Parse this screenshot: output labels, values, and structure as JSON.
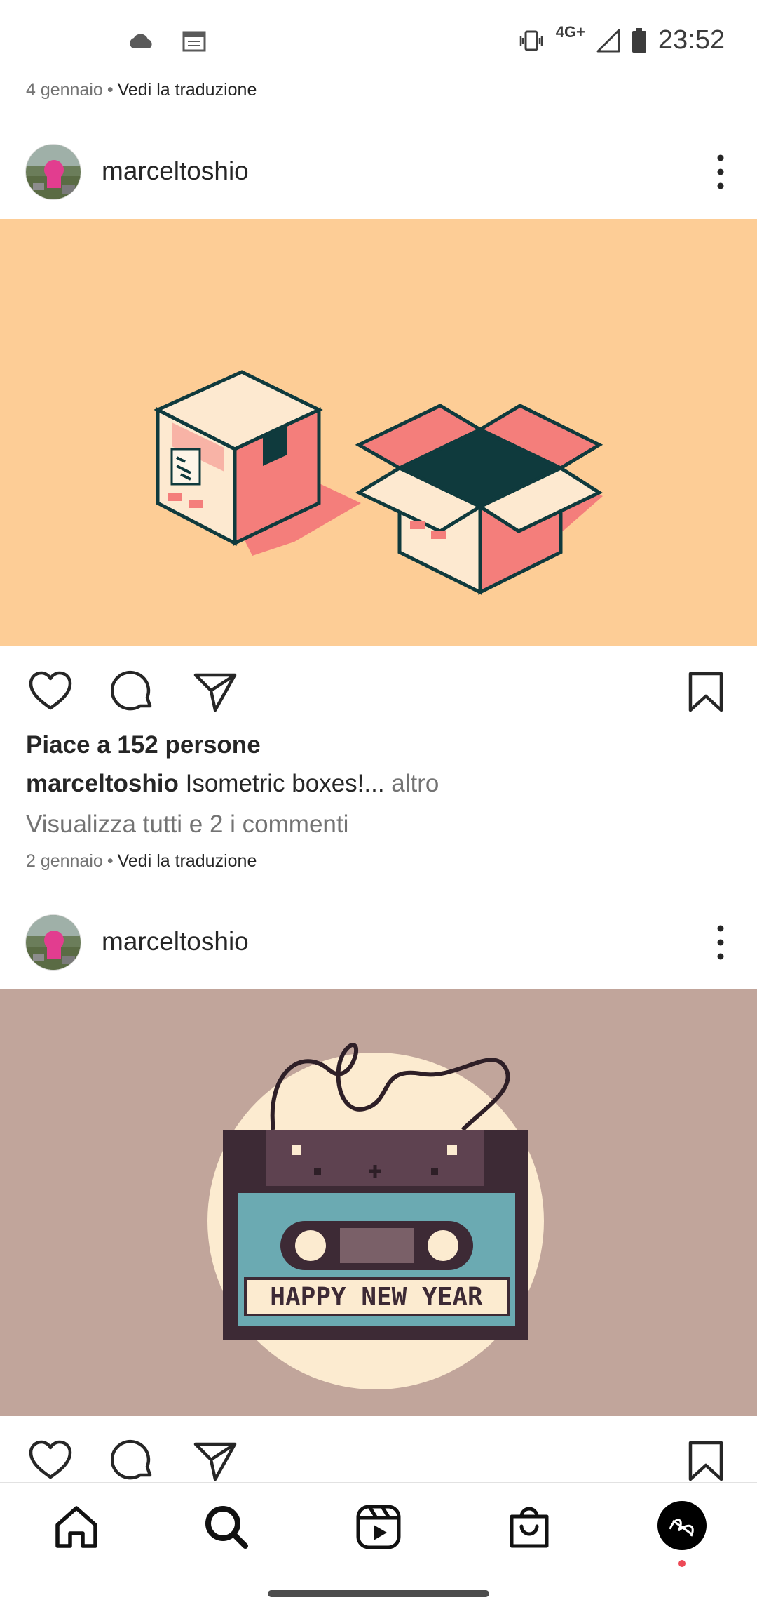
{
  "status_bar": {
    "time": "23:52",
    "network": "4G+",
    "icons": [
      "cloud-icon",
      "calendar-icon",
      "vibrate-icon",
      "signal-icon",
      "battery-icon"
    ]
  },
  "previous_post": {
    "date": "4 gennaio",
    "separator": "•",
    "translate": "Vedi la traduzione"
  },
  "posts": [
    {
      "username": "marceltoshio",
      "image_bg": "#fdcd96",
      "likes": "Piace a 152 persone",
      "caption_user": "marceltoshio",
      "caption_text": "Isometric boxes!...",
      "caption_more": " altro",
      "comments": "Visualizza tutti e 2 i commenti",
      "date": "2 gennaio",
      "separator": "•",
      "translate": "Vedi la traduzione"
    },
    {
      "username": "marceltoshio",
      "image_bg": "#c1a59b",
      "image_text": "HAPPY NEW YEAR"
    }
  ],
  "bottom_nav": {
    "items": [
      "home-icon",
      "search-icon",
      "reels-icon",
      "shop-icon",
      "profile-avatar"
    ],
    "notification_color": "#ed4956"
  },
  "colors": {
    "text": "#262626",
    "muted": "#737373",
    "box_pink": "#f47e7b",
    "box_dark": "#0f3a3d",
    "box_light": "#fde9d0",
    "cassette_blue": "#6baab2",
    "cassette_dark": "#3d2a35"
  }
}
